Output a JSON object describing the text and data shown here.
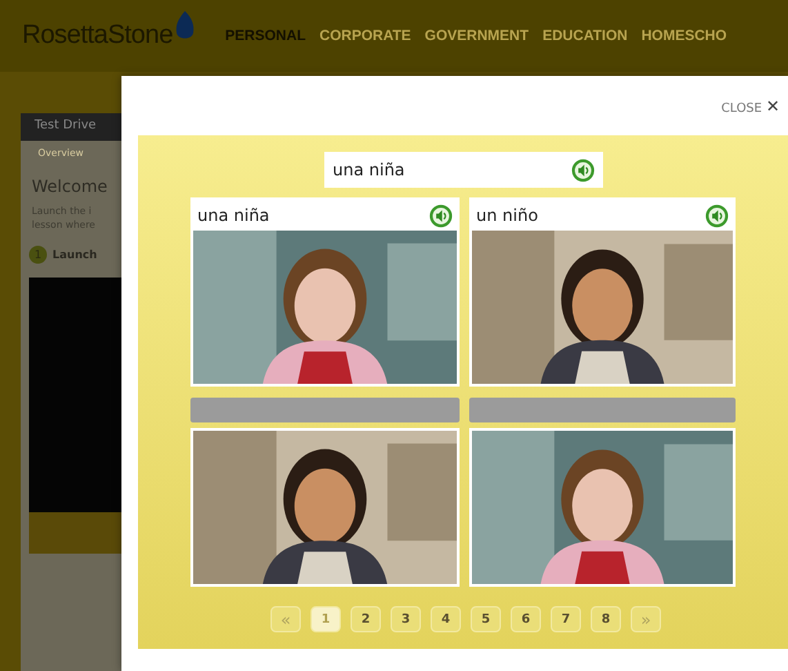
{
  "site_header": {
    "logo": "RosettaStone",
    "nav": [
      {
        "label": "PERSONAL",
        "selected": true
      },
      {
        "label": "CORPORATE",
        "selected": false
      },
      {
        "label": "GOVERNMENT",
        "selected": false
      },
      {
        "label": "EDUCATION",
        "selected": false
      },
      {
        "label": "HOMESCHO",
        "selected": false
      }
    ]
  },
  "background_page": {
    "tab": "Test Drive",
    "subtab": "Overview",
    "heading": "Welcome",
    "text_lines": [
      "Launch the i",
      "lesson where"
    ],
    "step_number": "1",
    "step_label": "Launch"
  },
  "modal": {
    "close_label": "CLOSE",
    "close_icon": "✕",
    "prompt": {
      "text": "una niña"
    },
    "cards": [
      {
        "kind": "labeled",
        "label": "una niña"
      },
      {
        "kind": "labeled",
        "label": "un niño"
      },
      {
        "kind": "blank"
      },
      {
        "kind": "blank"
      }
    ],
    "pagination": {
      "prev": "«",
      "next": "»",
      "pages": [
        {
          "label": "1",
          "selected": true
        },
        {
          "label": "2",
          "selected": false
        },
        {
          "label": "3",
          "selected": false
        },
        {
          "label": "4",
          "selected": false
        },
        {
          "label": "5",
          "selected": false
        },
        {
          "label": "6",
          "selected": false
        },
        {
          "label": "7",
          "selected": false
        },
        {
          "label": "8",
          "selected": false
        }
      ]
    }
  }
}
